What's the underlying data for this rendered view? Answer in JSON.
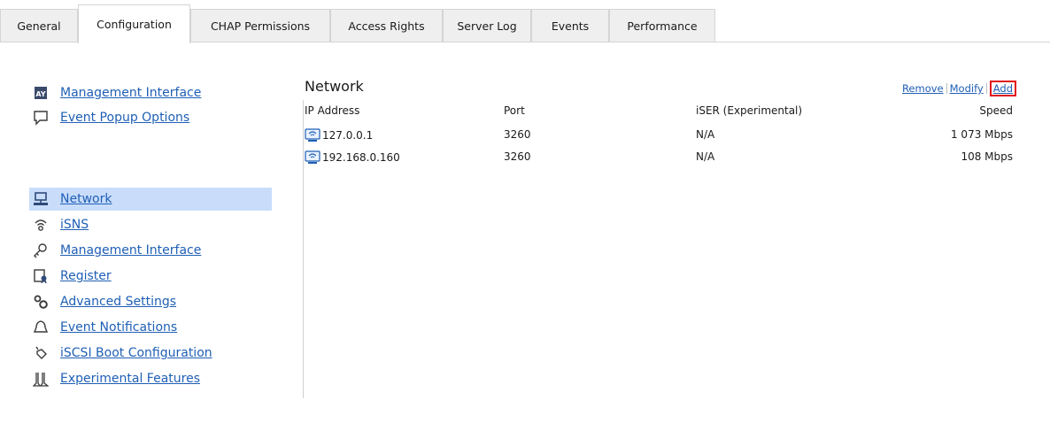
{
  "tabs": [
    {
      "label": "General",
      "active": false
    },
    {
      "label": "Configuration",
      "active": true
    },
    {
      "label": "CHAP Permissions",
      "active": false
    },
    {
      "label": "Access Rights",
      "active": false
    },
    {
      "label": "Server Log",
      "active": false
    },
    {
      "label": "Events",
      "active": false
    },
    {
      "label": "Performance",
      "active": false
    }
  ],
  "sidebar": {
    "top_items": [
      {
        "label": "Management Interface",
        "icon": "management-interface-icon"
      },
      {
        "label": "Event Popup Options",
        "icon": "popup-icon"
      }
    ],
    "items": [
      {
        "label": "Network",
        "icon": "network-icon",
        "selected": true
      },
      {
        "label": "iSNS",
        "icon": "isns-icon"
      },
      {
        "label": "Management Interface",
        "icon": "key-icon"
      },
      {
        "label": "Register",
        "icon": "register-icon"
      },
      {
        "label": "Advanced Settings",
        "icon": "settings-icon"
      },
      {
        "label": "Event Notifications",
        "icon": "bell-icon"
      },
      {
        "label": "iSCSI Boot Configuration",
        "icon": "boot-icon"
      },
      {
        "label": "Experimental Features",
        "icon": "flask-icon"
      }
    ]
  },
  "network": {
    "title": "Network",
    "actions": {
      "remove": "Remove",
      "modify": "Modify",
      "add": "Add"
    },
    "columns": {
      "ip": "IP Address",
      "port": "Port",
      "iser": "iSER (Experimental)",
      "speed": "Speed"
    },
    "rows": [
      {
        "ip": "127.0.0.1",
        "port": "3260",
        "iser": "N/A",
        "speed": "1 073 Mbps"
      },
      {
        "ip": "192.168.0.160",
        "port": "3260",
        "iser": "N/A",
        "speed": "108 Mbps"
      }
    ]
  },
  "colors": {
    "accent_link": "#1f5fb5",
    "selection": "#c9ddfb",
    "highlight_box": "#e1141b"
  }
}
